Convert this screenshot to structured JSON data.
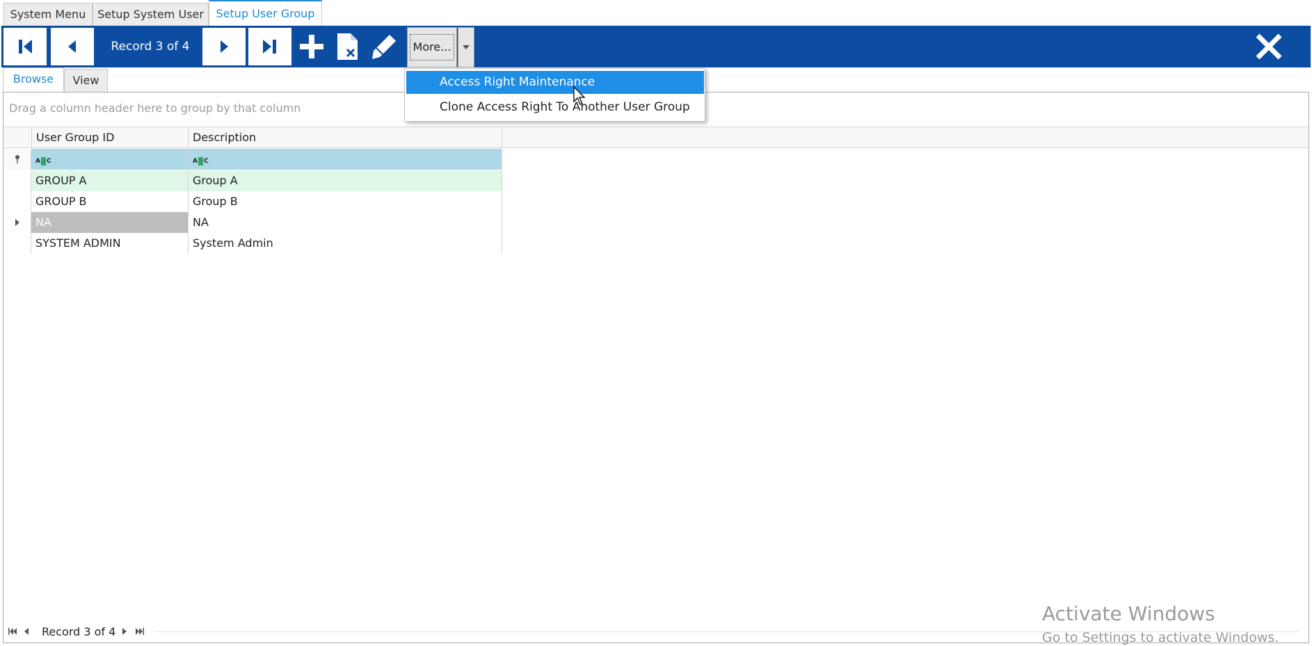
{
  "doc_tabs": [
    {
      "label": "System Menu"
    },
    {
      "label": "Setup System User"
    },
    {
      "label": "Setup User Group",
      "active": true
    }
  ],
  "toolbar": {
    "record_label": "Record 3 of 4",
    "more_label": "More...",
    "icons": [
      "first-record-icon",
      "previous-record-icon",
      "next-record-icon",
      "last-record-icon",
      "add-icon",
      "delete-document-icon",
      "edit-pencil-icon",
      "dropdown-arrow-icon",
      "close-icon"
    ]
  },
  "more_menu": {
    "items": [
      {
        "label": "Access Right Maintenance",
        "highlighted": true
      },
      {
        "label": "Clone Access Right To Another User Group"
      }
    ]
  },
  "view_tabs": [
    {
      "label": "Browse",
      "active": true
    },
    {
      "label": "View"
    }
  ],
  "grid": {
    "group_panel_hint": "Drag a column header here to group by that column",
    "columns": [
      "User Group ID",
      "Description"
    ],
    "rows": [
      {
        "id": "GROUP A",
        "description": "Group A"
      },
      {
        "id": "GROUP B",
        "description": "Group B"
      },
      {
        "id": "NA",
        "description": "NA",
        "current": true
      },
      {
        "id": "SYSTEM ADMIN",
        "description": "System Admin"
      }
    ]
  },
  "footer": {
    "record_label": "Record 3 of 4"
  },
  "watermark": {
    "line1": "Activate Windows",
    "line2": "Go to Settings to activate Windows."
  },
  "colors": {
    "toolbar": "#0c4da2",
    "accent": "#1e8ad6",
    "filter_row": "#add8e6",
    "first_row": "#dff7e6",
    "selected_cell": "#bdbdbd",
    "menu_highlight": "#1e8ee6"
  }
}
